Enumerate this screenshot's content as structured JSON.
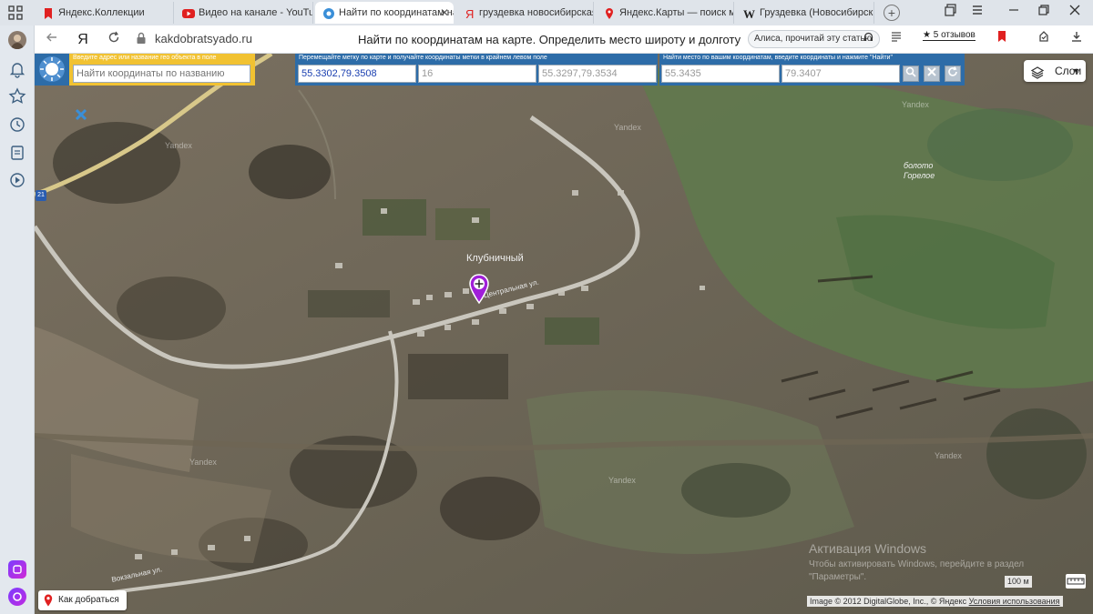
{
  "browser": {
    "tabs": [
      {
        "title": "Яндекс.Коллекции",
        "icon": "bookmark-icon"
      },
      {
        "title": "Видео на канале - YouTube",
        "icon": "youtube-icon"
      },
      {
        "title": "Найти по координатам на карте",
        "icon": "globe-icon",
        "active": true
      },
      {
        "title": "груздевка новосибирская",
        "icon": "yandex-icon"
      },
      {
        "title": "Яндекс.Карты — поиск мест",
        "icon": "map-pin-icon"
      },
      {
        "title": "Груздевка (Новосибирская",
        "icon": "wikipedia-icon"
      }
    ],
    "new_tab": "+",
    "close_glyph": "✕",
    "address": {
      "yandex_glyph": "Я",
      "url": "kakdobratsyado.ru",
      "page_title": "Найти по координатам на карте. Определить место широту и долготу",
      "alice": "Алиса, прочитай эту статью",
      "reviews": "★ 5 отзывов"
    }
  },
  "map_controls": {
    "search": {
      "caption": "Введите адрес или название гео объекта в поле",
      "placeholder": "Найти координаты по названию"
    },
    "marker_coords": {
      "caption": "Перемещайте метку по карте и получайте координаты метки в крайнем левом поле",
      "point": "55.3302,79.3508",
      "zoom": "16",
      "center": "55.3297,79.3534"
    },
    "find_by_coords": {
      "caption": "Найти место по вашим координатам, введите координаты и нажмите \"Найти\"",
      "lat": "55.3435",
      "lon": "79.3407"
    },
    "layers": "Слои"
  },
  "map": {
    "labels": {
      "village": "Клубничный",
      "street": "Центральная ул.",
      "swamp": "болото\nГорелое",
      "station_street": "Вокзальная ул."
    },
    "watermark": "Yandex",
    "road_number": "21",
    "route_button": "Как добраться",
    "activation_title": "Активация Windows",
    "activation_text": "Чтобы активировать Windows, перейдите в раздел \"Параметры\".",
    "scale": "100 м",
    "copyright": "Image © 2012 DigitalGlobe, Inc., © Яндекс",
    "terms": "Условия использования"
  },
  "colors": {
    "panel_blue": "#2d6ca8",
    "panel_yellow": "#f1c232",
    "marker": "#a01fd8"
  }
}
